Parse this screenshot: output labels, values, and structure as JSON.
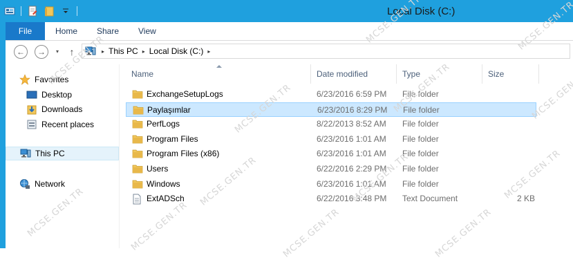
{
  "window": {
    "title": "Local Disk (C:)"
  },
  "quick_access_toolbar": {
    "icons": [
      "properties-icon",
      "new-folder-icon",
      "customize-dropdown-icon"
    ]
  },
  "ribbon": {
    "tabs": [
      "File",
      "Home",
      "Share",
      "View"
    ]
  },
  "navigation": {
    "back": "←",
    "forward": "→",
    "history": "▾",
    "up": "↑",
    "breadcrumb": [
      "This PC",
      "Local Disk (C:)"
    ],
    "separator": "▸"
  },
  "nav_pane": {
    "favorites_label": "Favorites",
    "favorites": [
      "Desktop",
      "Downloads",
      "Recent places"
    ],
    "this_pc": "This PC",
    "network": "Network"
  },
  "columns": {
    "name": "Name",
    "date": "Date modified",
    "type": "Type",
    "size": "Size"
  },
  "files": [
    {
      "name": "ExchangeSetupLogs",
      "date": "6/23/2016 6:59 PM",
      "type": "File folder",
      "size": "",
      "icon": "folder-icon",
      "selected": false
    },
    {
      "name": "Paylaşımlar",
      "date": "6/23/2016 8:29 PM",
      "type": "File folder",
      "size": "",
      "icon": "folder-icon",
      "selected": true
    },
    {
      "name": "PerfLogs",
      "date": "8/22/2013 8:52 AM",
      "type": "File folder",
      "size": "",
      "icon": "folder-icon",
      "selected": false
    },
    {
      "name": "Program Files",
      "date": "6/23/2016 1:01 AM",
      "type": "File folder",
      "size": "",
      "icon": "folder-icon",
      "selected": false
    },
    {
      "name": "Program Files (x86)",
      "date": "6/23/2016 1:01 AM",
      "type": "File folder",
      "size": "",
      "icon": "folder-icon",
      "selected": false
    },
    {
      "name": "Users",
      "date": "6/22/2016 2:29 PM",
      "type": "File folder",
      "size": "",
      "icon": "folder-icon",
      "selected": false
    },
    {
      "name": "Windows",
      "date": "6/23/2016 1:01 AM",
      "type": "File folder",
      "size": "",
      "icon": "folder-icon",
      "selected": false
    },
    {
      "name": "ExtADSch",
      "date": "6/22/2016 3:48 PM",
      "type": "Text Document",
      "size": "2 KB",
      "icon": "text-document-icon",
      "selected": false
    }
  ],
  "watermark": "MCSE.GEN.TR",
  "colors": {
    "titlebar": "#1fa0de",
    "file_tab": "#1979ca",
    "selection": "#cce8ff",
    "folder": "#e8b84a"
  }
}
